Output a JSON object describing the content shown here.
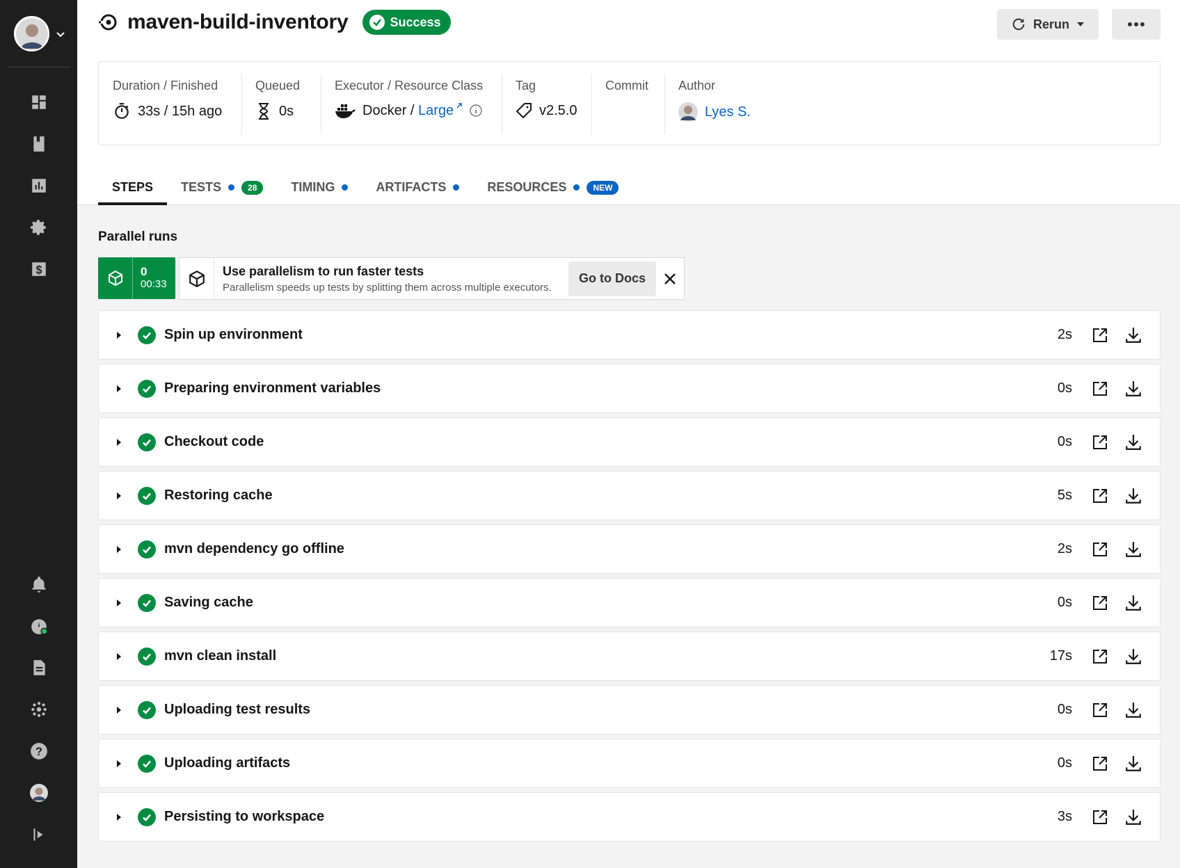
{
  "header": {
    "pipeline_title": "maven-build-inventory",
    "status": "Success",
    "rerun_label": "Rerun"
  },
  "meta": {
    "duration": {
      "label": "Duration / Finished",
      "value": "33s / 15h ago"
    },
    "queued": {
      "label": "Queued",
      "value": "0s"
    },
    "executor": {
      "label": "Executor / Resource Class",
      "value_prefix": "Docker / ",
      "resource_class": "Large"
    },
    "tag": {
      "label": "Tag",
      "value": "v2.5.0"
    },
    "commit": {
      "label": "Commit",
      "value": ""
    },
    "author": {
      "label": "Author",
      "name": "Lyes S."
    }
  },
  "tabs": [
    {
      "label": "STEPS",
      "active": true
    },
    {
      "label": "TESTS",
      "count": "28"
    },
    {
      "label": "TIMING"
    },
    {
      "label": "ARTIFACTS"
    },
    {
      "label": "RESOURCES",
      "badge": "NEW"
    }
  ],
  "parallel": {
    "title": "Parallel runs",
    "run_index": "0",
    "run_time": "00:33",
    "tip_heading": "Use parallelism to run faster tests",
    "tip_text": "Parallelism speeds up tests by splitting them across multiple executors.",
    "docs_label": "Go to Docs"
  },
  "steps": [
    {
      "name": "Spin up environment",
      "duration": "2s"
    },
    {
      "name": "Preparing environment variables",
      "duration": "0s"
    },
    {
      "name": "Checkout code",
      "duration": "0s"
    },
    {
      "name": "Restoring cache",
      "duration": "5s"
    },
    {
      "name": "mvn dependency go offline",
      "duration": "2s"
    },
    {
      "name": "Saving cache",
      "duration": "0s"
    },
    {
      "name": "mvn clean install",
      "duration": "17s"
    },
    {
      "name": "Uploading test results",
      "duration": "0s"
    },
    {
      "name": "Uploading artifacts",
      "duration": "0s"
    },
    {
      "name": "Persisting to workspace",
      "duration": "3s"
    }
  ],
  "colors": {
    "success_green": "#048c43",
    "link_blue": "#0a65c2",
    "sidebar_bg": "#1e1e1e"
  }
}
